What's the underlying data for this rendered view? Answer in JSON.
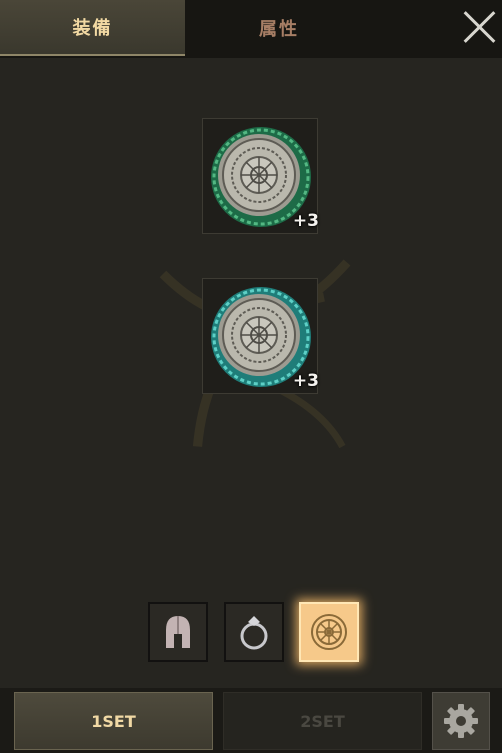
{
  "tabs": [
    {
      "label": "装備",
      "active": true
    },
    {
      "label": "属性",
      "active": false
    }
  ],
  "slots": [
    {
      "item": "green-runic-amulet",
      "enhance": "+3"
    },
    {
      "item": "teal-runic-amulet",
      "enhance": "+3"
    }
  ],
  "categories": [
    {
      "icon": "helmet-icon",
      "selected": false
    },
    {
      "icon": "ring-icon",
      "selected": false
    },
    {
      "icon": "amulet-icon",
      "selected": true
    }
  ],
  "sets": [
    {
      "label": "1SET",
      "active": true
    },
    {
      "label": "2SET",
      "active": false
    }
  ],
  "colors": {
    "accent": "#f6c98a",
    "tab_active_text": "#f2d9a3",
    "background": "#262520"
  }
}
